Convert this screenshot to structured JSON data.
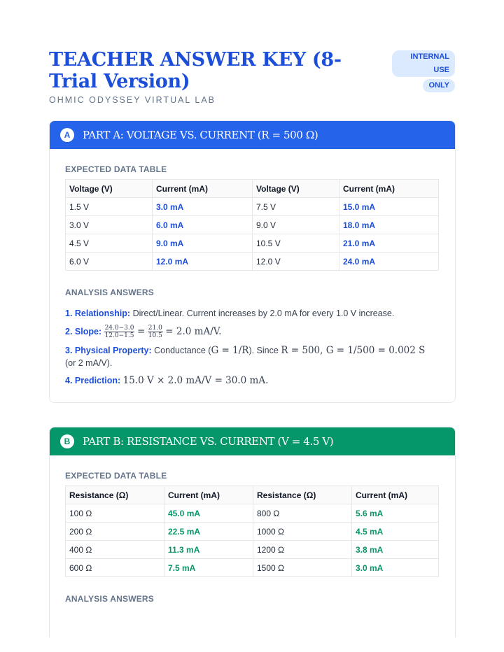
{
  "header": {
    "title": "TEACHER ANSWER KEY (8-Trial Version)",
    "subtitle": "OHMIC ODYSSEY VIRTUAL LAB",
    "badge_line1": "INTERNAL USE",
    "badge_line2": "ONLY"
  },
  "colors": {
    "part_a": "#2563eb",
    "part_b": "#059669",
    "title": "#1d4ed8"
  },
  "part_a": {
    "marker": "A",
    "title": "PART A: VOLTAGE VS. CURRENT (R = 500 Ω)",
    "table_label": "EXPECTED DATA TABLE",
    "columns": [
      "Voltage (V)",
      "Current (mA)",
      "Voltage (V)",
      "Current (mA)"
    ],
    "rows": [
      [
        "1.5 V",
        "3.0 mA",
        "7.5 V",
        "15.0 mA"
      ],
      [
        "3.0 V",
        "6.0 mA",
        "9.0 V",
        "18.0 mA"
      ],
      [
        "4.5 V",
        "9.0 mA",
        "10.5 V",
        "21.0 mA"
      ],
      [
        "6.0 V",
        "12.0 mA",
        "12.0 V",
        "24.0 mA"
      ]
    ],
    "analysis_label": "ANALYSIS ANSWERS",
    "answers": {
      "relationship_key": "1. Relationship:",
      "relationship_text": "Direct/Linear. Current increases by 2.0 mA for every 1.0 V increase.",
      "slope_key": "2. Slope:",
      "slope_num1": "24.0−3.0",
      "slope_den1": "12.0−1.5",
      "slope_eq": "=",
      "slope_num2": "21.0",
      "slope_den2": "10.5",
      "slope_result": "= 2.0 mA/V.",
      "physical_key": "3. Physical Property:",
      "physical_text_1": "Conductance (",
      "physical_math_1": "G = 1/R",
      "physical_text_2": "). Since ",
      "physical_math_2": "R = 500, G = 1/500 = 0.002 S",
      "physical_text_3": "(or 2 mA/V).",
      "prediction_key": "4. Prediction:",
      "prediction_math": "15.0 V × 2.0 mA/V = 30.0 mA."
    }
  },
  "part_b": {
    "marker": "B",
    "title": "PART B: RESISTANCE VS. CURRENT (V = 4.5 V)",
    "table_label": "EXPECTED DATA TABLE",
    "columns": [
      "Resistance (Ω)",
      "Current (mA)",
      "Resistance (Ω)",
      "Current (mA)"
    ],
    "rows": [
      [
        "100 Ω",
        "45.0 mA",
        "800 Ω",
        "5.6 mA"
      ],
      [
        "200 Ω",
        "22.5 mA",
        "1000 Ω",
        "4.5 mA"
      ],
      [
        "400 Ω",
        "11.3 mA",
        "1200 Ω",
        "3.8 mA"
      ],
      [
        "600 Ω",
        "7.5 mA",
        "1500 Ω",
        "3.0 mA"
      ]
    ],
    "analysis_label": "ANALYSIS ANSWERS"
  }
}
